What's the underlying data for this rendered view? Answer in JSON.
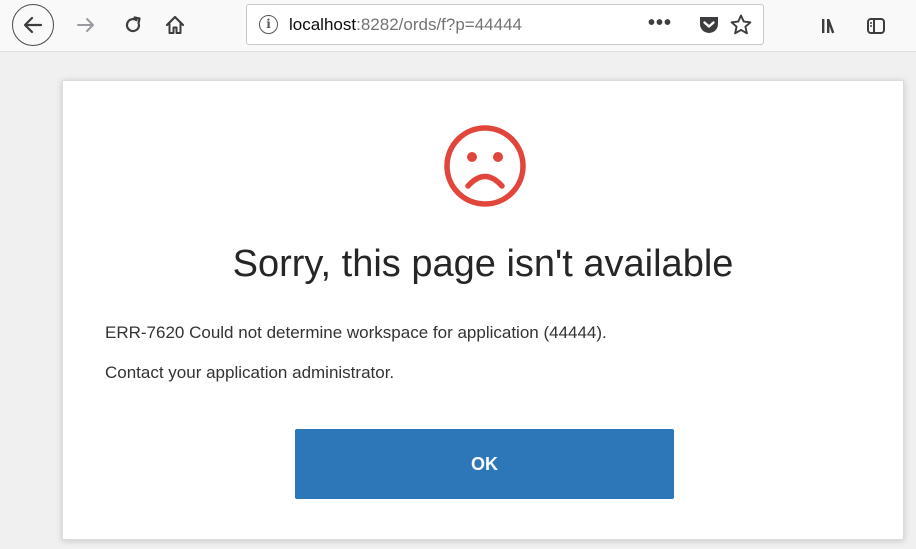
{
  "browser": {
    "url_host": "localhost",
    "url_rest": ":8282/ords/f?p=44444",
    "info_glyph": "i",
    "page_actions_glyph": "•••",
    "icons": [
      "back-arrow-icon",
      "forward-arrow-icon",
      "reload-icon",
      "home-icon",
      "info-icon",
      "page-actions-icon",
      "pocket-icon",
      "bookmark-star-icon",
      "library-icon",
      "sidebar-icon"
    ]
  },
  "dialog": {
    "title": "Sorry, this page isn't available",
    "message": "ERR-7620 Could not determine workspace for application (44444).",
    "hint": "Contact your application administrator.",
    "ok_label": "OK",
    "icon": "sad-face-icon"
  },
  "colors": {
    "sad_face": "#e2453b",
    "ok_button": "#2d76b8",
    "ok_text": "#ffffff",
    "page_background": "#f0f0f0"
  }
}
